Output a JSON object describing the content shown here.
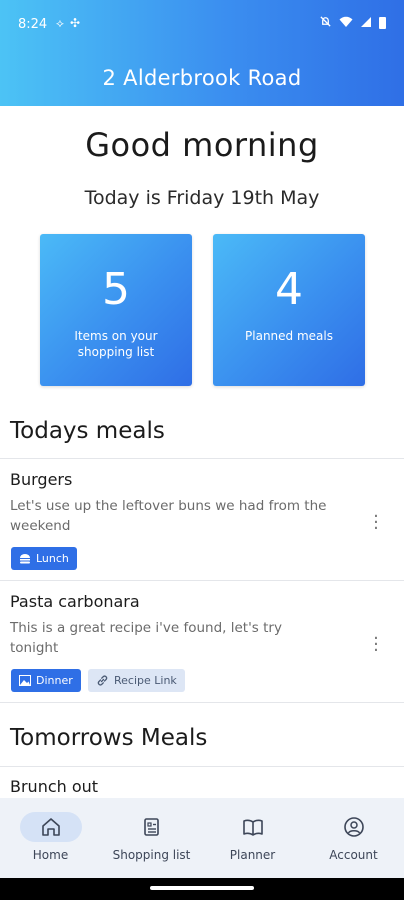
{
  "status_bar": {
    "time": "8:24"
  },
  "app": {
    "title": "2 Alderbrook Road"
  },
  "greeting": "Good morning",
  "today_text": "Today is Friday 19th May",
  "stats": [
    {
      "value": "5",
      "label": "Items on your shopping list"
    },
    {
      "value": "4",
      "label": "Planned meals"
    }
  ],
  "sections": {
    "today": "Todays meals",
    "tomorrow": "Tomorrows Meals"
  },
  "today_meals": [
    {
      "name": "Burgers",
      "description": "Let's use up the leftover buns we had from the weekend",
      "tags": [
        {
          "label": "Lunch",
          "icon": "burger-icon"
        }
      ]
    },
    {
      "name": "Pasta carbonara",
      "description": "This is a great recipe i've found, let's try tonight",
      "tags": [
        {
          "label": "Dinner",
          "icon": "image-icon"
        },
        {
          "label": "Recipe Link",
          "icon": "link-icon"
        }
      ]
    }
  ],
  "tomorrow_meals": [
    {
      "name": "Brunch out"
    }
  ],
  "nav": {
    "items": [
      {
        "label": "Home",
        "icon": "home-icon",
        "active": true
      },
      {
        "label": "Shopping list",
        "icon": "list-icon",
        "active": false
      },
      {
        "label": "Planner",
        "icon": "book-icon",
        "active": false
      },
      {
        "label": "Account",
        "icon": "account-icon",
        "active": false
      }
    ]
  },
  "colors": {
    "accent": "#2f6fe6",
    "gradient_start": "#4cc3f5",
    "nav_bg": "#eef2f8",
    "tag_soft": "#dde6f5"
  }
}
